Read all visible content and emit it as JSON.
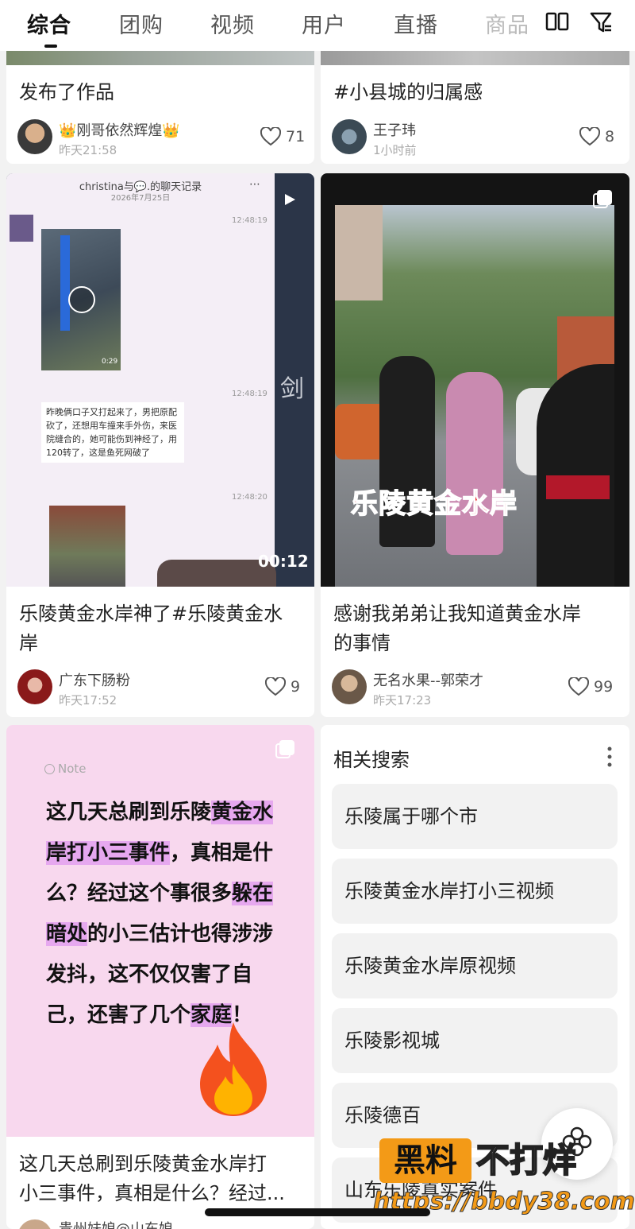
{
  "tabs": [
    "综合",
    "团购",
    "视频",
    "用户",
    "直播",
    "商品"
  ],
  "icons": {
    "layout": "two-column-icon",
    "filter": "filter-icon",
    "like": "heart-icon"
  },
  "cards": {
    "c1": {
      "title": "发布了作品",
      "user": "👑刚哥依然辉煌👑",
      "time": "昨天21:58",
      "likes": "71"
    },
    "c2": {
      "title": "#小县城的归属感",
      "user": "王子玮",
      "time": "1小时前",
      "likes": "8"
    },
    "c3": {
      "title_l1": "乐陵黄金水岸神了#乐陵黄金水",
      "title_l2": "岸",
      "user": "广东下肠粉",
      "time": "昨天17:52",
      "likes": "9",
      "thumb": {
        "chat_title": "christina与💬.的聊天记录",
        "chat_date": "2026年7月25日",
        "time1": "12:48:19",
        "time2": "12:48:19",
        "time3": "12:48:20",
        "video_len1": "0:29",
        "msg": "昨晚俩口子又打起来了，男把原配砍了，还想用车撞来手外伤，来医院缝合的，她可能伤到神经了，用120转了，这是鱼死网破了",
        "duration": "00:12",
        "side_char": "剑"
      }
    },
    "c4": {
      "title_l1": "感谢我弟弟让我知道黄金水岸",
      "title_l2": "的事情",
      "user": "无名水果--郭荣才",
      "time": "昨天17:23",
      "likes": "99",
      "overlay": "乐陵黄金水岸"
    },
    "c5": {
      "note_label": "Note",
      "note_parts": [
        "这几天总刷到乐陵",
        "黄金水岸打小三事件",
        "，真相是什么？经过这个事很多",
        "躲在暗处",
        "的小三估计也得涉涉发抖，这不仅仅害了自己，还害了几个",
        "家庭",
        "！"
      ],
      "title_l1": "这几天总刷到乐陵黄金水岸打",
      "title_l2": "小三事件，真相是什么？经过...",
      "user": "贵州妹娘@山东娘"
    }
  },
  "related": {
    "heading": "相关搜索",
    "items": [
      "乐陵属于哪个市",
      "乐陵黄金水岸打小三视频",
      "乐陵黄金水岸原视频",
      "乐陵影视城",
      "乐陵德百",
      "山东乐陵真实案件"
    ]
  },
  "watermark": {
    "box": "黑料",
    "text": "不打烊",
    "url": "https://bbdy38.com"
  }
}
